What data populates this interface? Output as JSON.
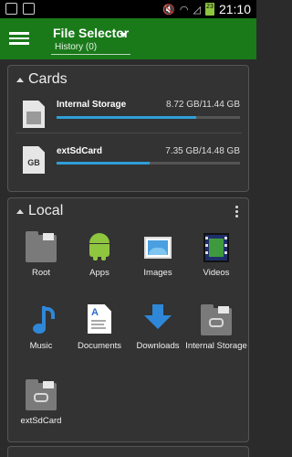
{
  "status_bar": {
    "time": "21:10",
    "battery": "23",
    "icons": [
      "screenshot-icon",
      "image-icon",
      "mute-icon",
      "wifi-icon",
      "no-signal-icon",
      "battery-icon"
    ]
  },
  "app_bar": {
    "title": "File Selector",
    "subtitle": "History (0)",
    "color": "#1a7a1a"
  },
  "cards_section": {
    "title": "Cards",
    "items": [
      {
        "name": "Internal Storage",
        "size": "8.72 GB/11.44 GB",
        "used_fraction": 0.762,
        "icon": "sd-card-icon"
      },
      {
        "name": "extSdCard",
        "size": "7.35 GB/14.48 GB",
        "used_fraction": 0.508,
        "icon": "sd-card-gb-icon",
        "icon_text": "GB"
      }
    ]
  },
  "local_section": {
    "title": "Local",
    "items": [
      {
        "label": "Root",
        "icon": "root-folder-icon"
      },
      {
        "label": "Apps",
        "icon": "android-icon"
      },
      {
        "label": "Images",
        "icon": "images-icon"
      },
      {
        "label": "Videos",
        "icon": "videos-icon"
      },
      {
        "label": "Music",
        "icon": "music-note-icon"
      },
      {
        "label": "Documents",
        "icon": "document-icon"
      },
      {
        "label": "Downloads",
        "icon": "download-arrow-icon"
      },
      {
        "label": "Internal Storage",
        "icon": "internal-storage-folder-icon"
      },
      {
        "label": "extSdCard",
        "icon": "sdcard-folder-icon"
      }
    ]
  },
  "colors": {
    "accent": "#2e9fd8",
    "card_bg": "#333333",
    "page_bg": "#2b2b2b"
  }
}
